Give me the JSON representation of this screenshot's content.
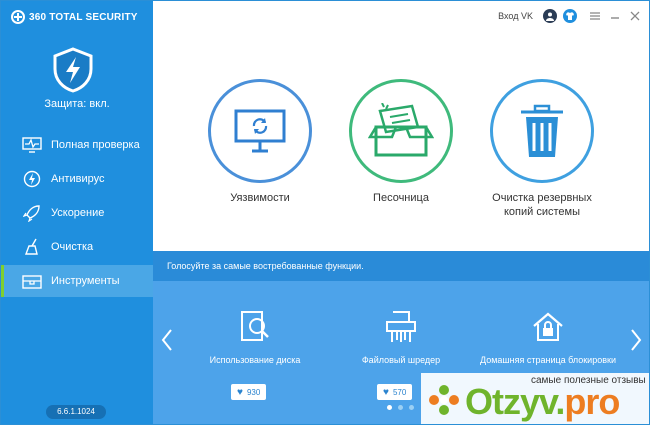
{
  "app": {
    "title": "360 TOTAL SECURITY",
    "version": "6.6.1.1024"
  },
  "sidebar": {
    "status": "Защита: вкл.",
    "items": [
      {
        "label": "Полная проверка",
        "icon": "monitor-pulse-icon"
      },
      {
        "label": "Антивирус",
        "icon": "bolt-circle-icon"
      },
      {
        "label": "Ускорение",
        "icon": "rocket-icon"
      },
      {
        "label": "Очистка",
        "icon": "broom-icon"
      },
      {
        "label": "Инструменты",
        "icon": "toolbox-icon",
        "active": true
      }
    ]
  },
  "header": {
    "login": "Вход VK"
  },
  "tools": [
    {
      "label": "Уязвимости",
      "icon": "monitor-refresh-icon",
      "color": "#4a90d9"
    },
    {
      "label": "Песочница",
      "icon": "sandbox-box-icon",
      "color": "#3fba7c"
    },
    {
      "label": "Очистка резервных копий системы",
      "icon": "trash-bin-icon",
      "color": "#3fa0e0"
    }
  ],
  "banner": "Голосуйте за самые востребованные функции.",
  "features": [
    {
      "label": "Использование диска",
      "likes": "930",
      "icon": "disk-usage-icon"
    },
    {
      "label": "Файловый шредер",
      "likes": "570",
      "icon": "shredder-icon"
    },
    {
      "label": "Домашняя страница блокировки",
      "icon": "home-lock-icon"
    }
  ],
  "watermark": {
    "tag": "самые полезные отзывы",
    "site_a": "Otzyv.",
    "site_b": "pro"
  }
}
